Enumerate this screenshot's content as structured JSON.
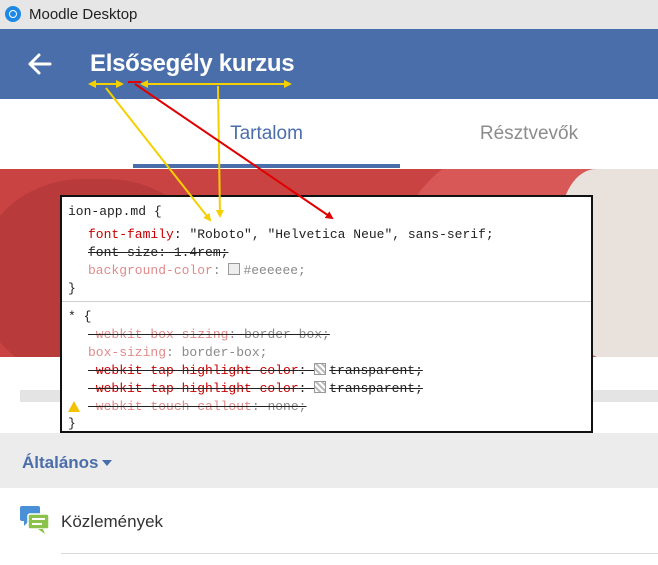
{
  "window": {
    "title": "Moodle Desktop"
  },
  "header": {
    "course_title": "Elsősegély kurzus"
  },
  "tabs": [
    {
      "label": "Tartalom",
      "active": true
    },
    {
      "label": "Résztvevők",
      "active": false
    }
  ],
  "devtools": {
    "rule1": {
      "selector": "ion-app.md {",
      "decl1_prop": "font-family",
      "decl1_val": "\"Roboto\", \"Helvetica Neue\", sans-serif;",
      "decl2": "font-size: 1.4rem;",
      "decl3_prop": "background-color",
      "decl3_val": "#eeeeee;",
      "close": "}"
    },
    "rule2": {
      "selector": "* {",
      "decl1_prop": "-webkit-box-sizing",
      "decl1_val": "border-box;",
      "decl2_prop": "box-sizing",
      "decl2_val": "border-box;",
      "decl3_prop": "-webkit-tap-highlight-color",
      "decl3_val": "transparent;",
      "decl4_prop": "-webkit-tap-highlight-color",
      "decl4_val": "transparent;",
      "decl5_prop": "-webkit-touch-callout",
      "decl5_val": "none;",
      "close": "}"
    }
  },
  "section": {
    "label": "Általános"
  },
  "activities": [
    {
      "label": "Közlemények",
      "icon": "forum-icon"
    }
  ],
  "colors": {
    "brand": "#4a6eaa",
    "arrow_yellow": "#f5d000",
    "arrow_red": "#e00000"
  }
}
